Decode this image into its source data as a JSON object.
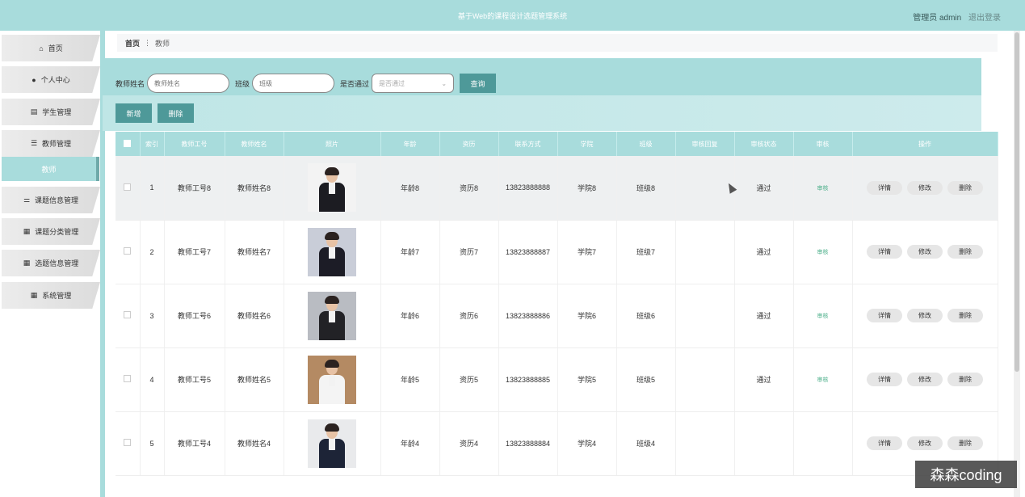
{
  "header": {
    "title": "基于Web的课程设计选题管理系统",
    "user_label": "管理员 admin",
    "logout_label": "退出登录"
  },
  "sidebar": {
    "items": [
      {
        "label": "首页",
        "icon": "home-icon"
      },
      {
        "label": "个人中心",
        "icon": "user-icon"
      },
      {
        "label": "学生管理",
        "icon": "clipboard-icon"
      },
      {
        "label": "教师管理",
        "icon": "list-icon"
      },
      {
        "label": "教师",
        "icon": ""
      },
      {
        "label": "课题信息管理",
        "icon": "sliders-icon"
      },
      {
        "label": "课题分类管理",
        "icon": "grid-icon"
      },
      {
        "label": "选题信息管理",
        "icon": "grid-icon"
      },
      {
        "label": "系统管理",
        "icon": "grid-icon"
      }
    ]
  },
  "breadcrumb": {
    "home": "首页",
    "separator": "⋮",
    "current": "教师"
  },
  "search": {
    "name_label": "教师姓名",
    "name_placeholder": "教师姓名",
    "class_label": "班级",
    "class_placeholder": "班级",
    "pass_label": "是否通过",
    "pass_placeholder": "是否通过",
    "query_button": "查询"
  },
  "actions": {
    "add": "新增",
    "delete": "删除"
  },
  "table": {
    "columns": [
      "索引",
      "教师工号",
      "教师姓名",
      "照片",
      "年龄",
      "资历",
      "联系方式",
      "学院",
      "班级",
      "审核回复",
      "审核状态",
      "审核",
      "操作"
    ],
    "rows": [
      {
        "index": "1",
        "id": "教师工号8",
        "name": "教师姓名8",
        "age": "年龄8",
        "qual": "资历8",
        "phone": "13823888888",
        "college": "学院8",
        "class": "班级8",
        "reply": "",
        "status": "通过",
        "audit": "审核",
        "photo_bg": "#f3f3f3",
        "body": "#1c1c22"
      },
      {
        "index": "2",
        "id": "教师工号7",
        "name": "教师姓名7",
        "age": "年龄7",
        "qual": "资历7",
        "phone": "13823888887",
        "college": "学院7",
        "class": "班级7",
        "reply": "",
        "status": "通过",
        "audit": "审核",
        "photo_bg": "#c9cdd8",
        "body": "#1c1c26"
      },
      {
        "index": "3",
        "id": "教师工号6",
        "name": "教师姓名6",
        "age": "年龄6",
        "qual": "资历6",
        "phone": "13823888886",
        "college": "学院6",
        "class": "班级6",
        "reply": "",
        "status": "通过",
        "audit": "审核",
        "photo_bg": "#b9bcc2",
        "body": "#222226"
      },
      {
        "index": "4",
        "id": "教师工号5",
        "name": "教师姓名5",
        "age": "年龄5",
        "qual": "资历5",
        "phone": "13823888885",
        "college": "学院5",
        "class": "班级5",
        "reply": "",
        "status": "通过",
        "audit": "审核",
        "photo_bg": "#b48a63",
        "body": "#f4f4f4"
      },
      {
        "index": "5",
        "id": "教师工号4",
        "name": "教师姓名4",
        "age": "年龄4",
        "qual": "资历4",
        "phone": "13823888884",
        "college": "学院4",
        "class": "班级4",
        "reply": "",
        "status": "",
        "audit": "",
        "photo_bg": "#e9eaec",
        "body": "#1d2437"
      }
    ],
    "op_labels": {
      "detail": "详情",
      "edit": "修改",
      "delete": "删除"
    }
  },
  "watermark": "森森coding",
  "colors": {
    "accent": "#a8dcdc",
    "button": "#4e9999",
    "audit": "#4caf8a"
  }
}
